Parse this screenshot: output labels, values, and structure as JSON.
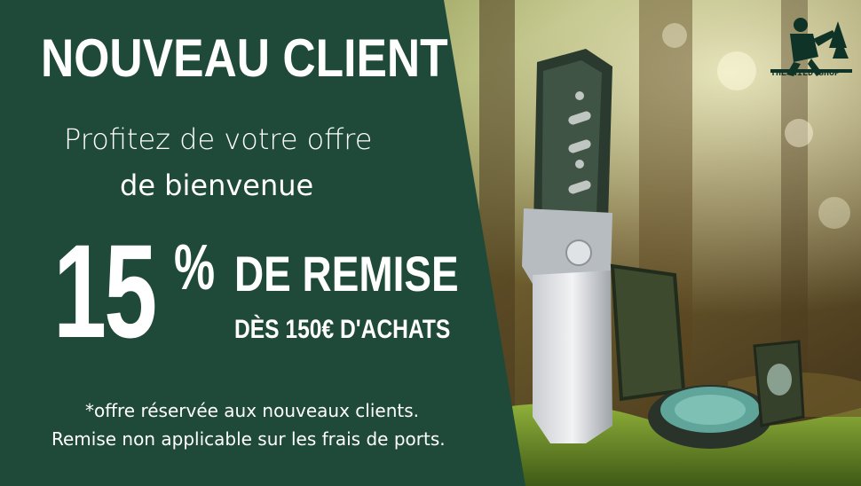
{
  "banner": {
    "title": "NOUVEAU CLIENT",
    "subtitle_line1": "Profitez de votre offre",
    "subtitle_line2": "de bienvenue",
    "discount_number": "15",
    "discount_symbol": "%",
    "discount_label": "DE REMISE",
    "condition": "DÈS 150€ D'ACHATS",
    "note_line1": "*offre réservée aux nouveaux clients.",
    "note_line2": "Remise non applicable sur les frais de ports."
  },
  "brand": {
    "logo_text": "THE WILD SHOP",
    "logo_icon": "lumberjack-icon"
  },
  "photo": {
    "subject": "knife-and-compass-photo"
  },
  "colors": {
    "panel": "#1f4a3a",
    "text": "#ffffff",
    "forest_dark": "#2e3a1c",
    "moss": "#6f8f2a"
  }
}
